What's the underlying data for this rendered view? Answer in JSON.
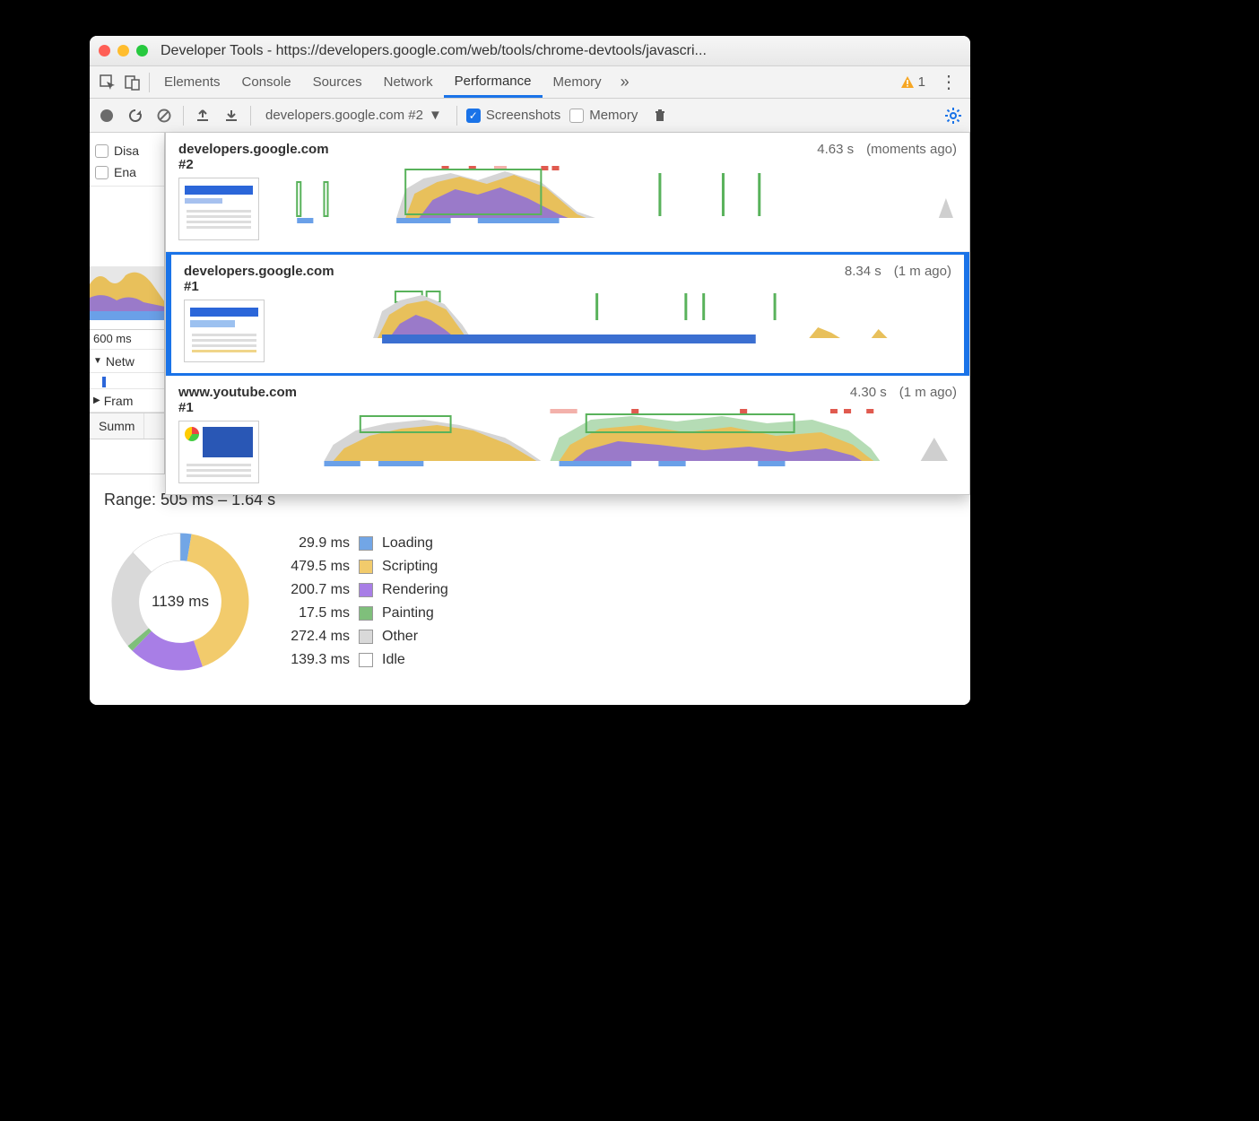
{
  "window": {
    "title": "Developer Tools - https://developers.google.com/web/tools/chrome-devtools/javascri..."
  },
  "tabs": {
    "items": [
      "Elements",
      "Console",
      "Sources",
      "Network",
      "Performance",
      "Memory"
    ],
    "active": "Performance",
    "overflow_icon": "»",
    "warning_count": "1"
  },
  "toolbar": {
    "recording_select": "developers.google.com #2",
    "screenshots_label": "Screenshots",
    "memory_label": "Memory"
  },
  "left_panel": {
    "checkbox1": "Disa",
    "checkbox2": "Ena",
    "time_label": "600 ms",
    "rows": [
      "Netw",
      "Fram"
    ],
    "tab": "Summ"
  },
  "recordings": [
    {
      "name": "developers.google.com #2",
      "duration": "4.63 s",
      "when": "(moments ago)",
      "selected": false
    },
    {
      "name": "developers.google.com #1",
      "duration": "8.34 s",
      "when": "(1 m ago)",
      "selected": true
    },
    {
      "name": "www.youtube.com #1",
      "duration": "4.30 s",
      "when": "(1 m ago)",
      "selected": false
    }
  ],
  "summary": {
    "range_label": "Range: 505 ms – 1.64 s",
    "total_label": "1139 ms",
    "items": [
      {
        "ms": "29.9 ms",
        "label": "Loading",
        "color": "#72a6e6"
      },
      {
        "ms": "479.5 ms",
        "label": "Scripting",
        "color": "#f2cb6c"
      },
      {
        "ms": "200.7 ms",
        "label": "Rendering",
        "color": "#a87ee6"
      },
      {
        "ms": "17.5 ms",
        "label": "Painting",
        "color": "#7fbf7b"
      },
      {
        "ms": "272.4 ms",
        "label": "Other",
        "color": "#d9d9d9"
      },
      {
        "ms": "139.3 ms",
        "label": "Idle",
        "color": "#ffffff"
      }
    ]
  },
  "chart_data": {
    "type": "pie",
    "title": "Range: 505 ms – 1.64 s",
    "total_ms": 1139,
    "series": [
      {
        "name": "Loading",
        "value_ms": 29.9,
        "color": "#72a6e6"
      },
      {
        "name": "Scripting",
        "value_ms": 479.5,
        "color": "#f2cb6c"
      },
      {
        "name": "Rendering",
        "value_ms": 200.7,
        "color": "#a87ee6"
      },
      {
        "name": "Painting",
        "value_ms": 17.5,
        "color": "#7fbf7b"
      },
      {
        "name": "Other",
        "value_ms": 272.4,
        "color": "#d9d9d9"
      },
      {
        "name": "Idle",
        "value_ms": 139.3,
        "color": "#ffffff"
      }
    ]
  }
}
